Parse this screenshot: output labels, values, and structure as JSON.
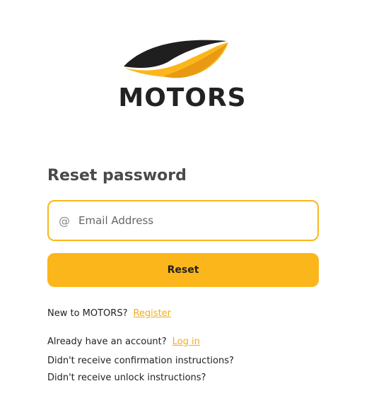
{
  "brand": {
    "name": "MOTORS",
    "accent_color": "#fbb61b",
    "logo_icon": "swoosh-logo-icon"
  },
  "form": {
    "heading": "Reset password",
    "email_placeholder": "Email Address",
    "email_icon": "at-icon",
    "submit_label": "Reset"
  },
  "links": {
    "new_prompt": "New to MOTORS?",
    "register_label": "Register",
    "account_prompt": "Already have an account?",
    "login_label": "Log in",
    "confirmation_label": "Didn't receive confirmation instructions?",
    "unlock_label": "Didn't receive unlock instructions?"
  }
}
